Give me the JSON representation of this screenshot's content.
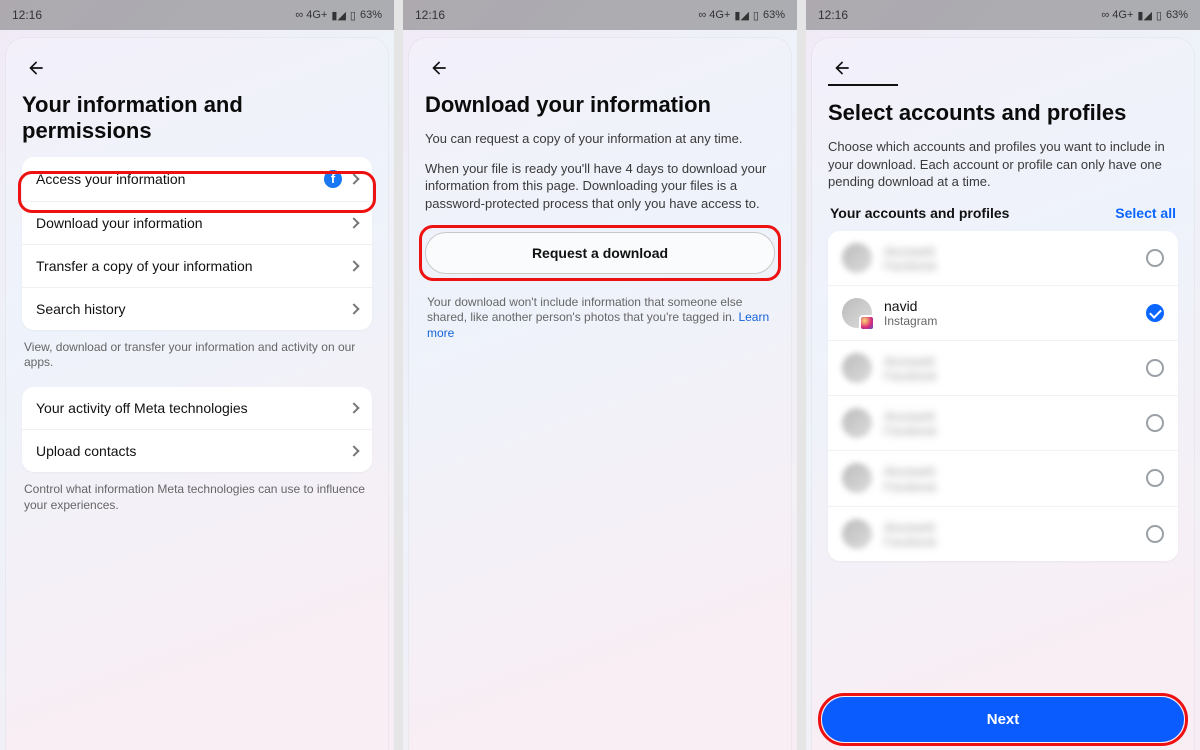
{
  "status": {
    "time": "12:16",
    "net": "4G+",
    "battery": "63%"
  },
  "screen1": {
    "title": "Your information and permissions",
    "items1": [
      {
        "label": "Access your information",
        "fb": true
      },
      {
        "label": "Download your information",
        "fb": false
      },
      {
        "label": "Transfer a copy of your information",
        "fb": false
      },
      {
        "label": "Search history",
        "fb": false
      }
    ],
    "caption1": "View, download or transfer your information and activity on our apps.",
    "items2": [
      {
        "label": "Your activity off Meta technologies"
      },
      {
        "label": "Upload contacts"
      }
    ],
    "caption2": "Control what information Meta technologies can use to influence your experiences."
  },
  "screen2": {
    "title": "Download your information",
    "p1": "You can request a copy of your information at any time.",
    "p2": "When your file is ready you'll have 4 days to download your information from this page. Downloading your files is a password-protected process that only you have access to.",
    "button": "Request a download",
    "note": "Your download won't include information that someone else shared, like another person's photos that you're tagged in. ",
    "learn": "Learn more"
  },
  "screen3": {
    "title": "Select accounts and profiles",
    "p": "Choose which accounts and profiles you want to include in your download. Each account or profile can only have one pending download at a time.",
    "section_label": "Your accounts and profiles",
    "select_all": "Select all",
    "accounts": [
      {
        "name": "Account",
        "sub": "Facebook",
        "blur": true,
        "checked": false,
        "ig": false
      },
      {
        "name": "navid",
        "sub": "Instagram",
        "blur": false,
        "checked": true,
        "ig": true
      },
      {
        "name": "Account",
        "sub": "Facebook",
        "blur": true,
        "checked": false,
        "ig": false
      },
      {
        "name": "Account",
        "sub": "Facebook",
        "blur": true,
        "checked": false,
        "ig": false
      },
      {
        "name": "Account",
        "sub": "Facebook",
        "blur": true,
        "checked": false,
        "ig": false
      },
      {
        "name": "Account",
        "sub": "Facebook",
        "blur": true,
        "checked": false,
        "ig": false
      }
    ],
    "next": "Next"
  }
}
